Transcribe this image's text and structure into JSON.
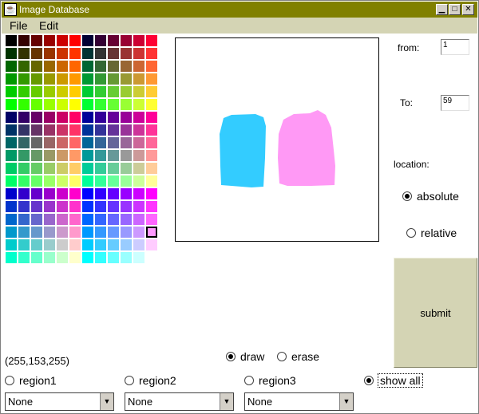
{
  "window": {
    "title": "Image Database",
    "app_icon": "java-cup-icon"
  },
  "titlebar_buttons": [
    {
      "name": "minimize-button",
      "glyph": "▁"
    },
    {
      "name": "maximize-button",
      "glyph": "□"
    },
    {
      "name": "close-button",
      "glyph": "✕"
    }
  ],
  "menu": {
    "items": [
      "File",
      "Edit"
    ]
  },
  "palette": {
    "rows": 18,
    "cols": 12,
    "selected": {
      "row": 15,
      "col": 11
    },
    "last_row_cols": 11
  },
  "canvas": {
    "shapes": [
      {
        "name": "cyan-region",
        "color": "#33ccff"
      },
      {
        "name": "pink-region",
        "color": "#ff99f5"
      }
    ]
  },
  "range": {
    "from_label": "from:",
    "from_value": "1",
    "to_label": "To:",
    "to_value": "59"
  },
  "location": {
    "label": "location:",
    "absolute": "absolute",
    "relative": "relative",
    "selected": "absolute"
  },
  "submit_label": "submit",
  "color_readout": "(255,153,255)",
  "tool": {
    "draw": "draw",
    "erase": "erase",
    "selected": "draw"
  },
  "regions": {
    "region1": "region1",
    "region2": "region2",
    "region3": "region3",
    "show_all": "show all",
    "selected": "show all"
  },
  "selects": [
    "None",
    "None",
    "None"
  ]
}
